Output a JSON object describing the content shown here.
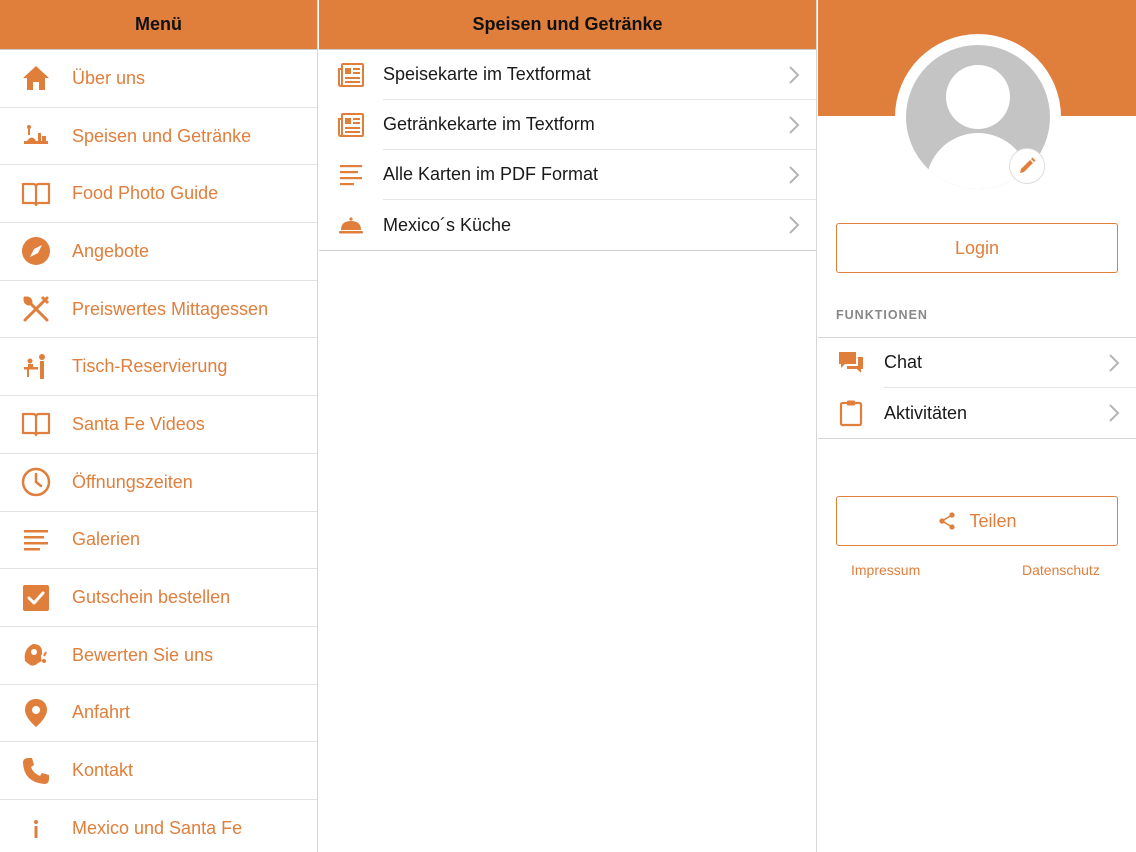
{
  "theme": {
    "accent": "#e07e3c",
    "divider": "#e2e2e2",
    "avatar_gray": "#c4c4c4"
  },
  "menu": {
    "title": "Menü",
    "items": [
      {
        "label": "Über uns",
        "icon": "home-icon"
      },
      {
        "label": "Speisen und Getränke",
        "icon": "food-icon"
      },
      {
        "label": "Food Photo Guide",
        "icon": "book-icon"
      },
      {
        "label": "Angebote",
        "icon": "compass-icon"
      },
      {
        "label": "Preiswertes Mittagessen",
        "icon": "cutlery-icon"
      },
      {
        "label": "Tisch-Reservierung",
        "icon": "reservation-icon"
      },
      {
        "label": "Santa Fe Videos",
        "icon": "book-icon"
      },
      {
        "label": "Öffnungszeiten",
        "icon": "clock-icon"
      },
      {
        "label": "Galerien",
        "icon": "lines-icon"
      },
      {
        "label": "Gutschein bestellen",
        "icon": "checkbox-icon"
      },
      {
        "label": "Bewerten Sie uns",
        "icon": "rating-icon"
      },
      {
        "label": "Anfahrt",
        "icon": "location-pin-icon"
      },
      {
        "label": "Kontakt",
        "icon": "phone-icon"
      },
      {
        "label": "Mexico und Santa Fe",
        "icon": "info-icon"
      }
    ]
  },
  "middle": {
    "title": "Speisen und Getränke",
    "items": [
      {
        "label": "Speisekarte im Textformat",
        "icon": "newspaper-icon"
      },
      {
        "label": "Getränkekarte im Textform",
        "icon": "newspaper-icon"
      },
      {
        "label": "Alle Karten im PDF Format",
        "icon": "lines-icon"
      },
      {
        "label": "Mexico´s Küche",
        "icon": "cloche-icon"
      }
    ]
  },
  "profile": {
    "login_label": "Login",
    "section_label": "FUNKTIONEN",
    "functions": [
      {
        "label": "Chat",
        "icon": "chat-icon"
      },
      {
        "label": "Aktivitäten",
        "icon": "clipboard-icon"
      }
    ],
    "share_label": "Teilen",
    "impressum_label": "Impressum",
    "datenschutz_label": "Datenschutz"
  }
}
